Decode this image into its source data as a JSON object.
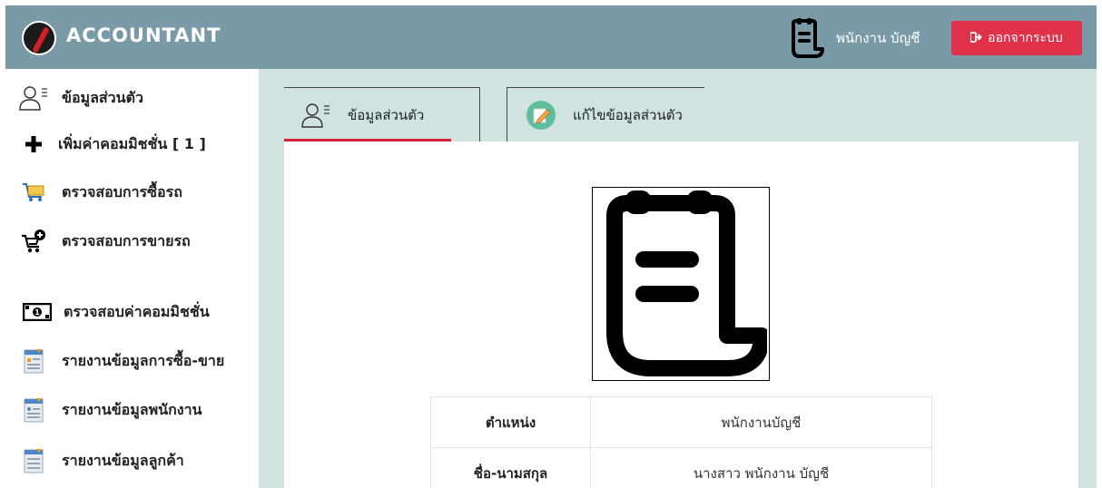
{
  "header": {
    "app_title": "ACCOUNTANT",
    "user_name": "พนักงาน บัญชี",
    "logout_label": "ออกจากระบบ"
  },
  "sidebar": {
    "items": [
      {
        "label": "ข้อมูลส่วนตัว",
        "icon": "user-profile-icon"
      },
      {
        "label": "เพิ่มค่าคอมมิชชั่น [ 1 ]",
        "icon": "plus-icon"
      },
      {
        "label": "ตรวจสอบการซื้อรถ",
        "icon": "cart-icon"
      },
      {
        "label": "ตรวจสอบการขายรถ",
        "icon": "cart-add-icon"
      },
      {
        "label": "ตรวจสอบค่าคอมมิชชั่น",
        "icon": "money-icon"
      },
      {
        "label": "รายงานข้อมูลการซื้อ-ขาย",
        "icon": "report-icon"
      },
      {
        "label": "รายงานข้อมูลพนักงาน",
        "icon": "report-icon"
      },
      {
        "label": "รายงานข้อมูลลูกค้า",
        "icon": "report-icon"
      }
    ]
  },
  "tabs": [
    {
      "label": "ข้อมูลส่วนตัว",
      "icon": "user-profile-icon"
    },
    {
      "label": "แก้ไขข้อมูลส่วนตัว",
      "icon": "edit-icon"
    }
  ],
  "profile": {
    "rows": [
      {
        "label": "ตำแหน่ง",
        "value": "พนักงานบัญชี"
      },
      {
        "label": "ชื่อ-นามสกุล",
        "value": "นางสาว พนักงาน บัญชี"
      }
    ]
  },
  "colors": {
    "header_bg": "#7a9aa8",
    "content_bg": "#d0e3e1",
    "logout_bg": "#e0314a",
    "tab_active": "#d9203b"
  }
}
